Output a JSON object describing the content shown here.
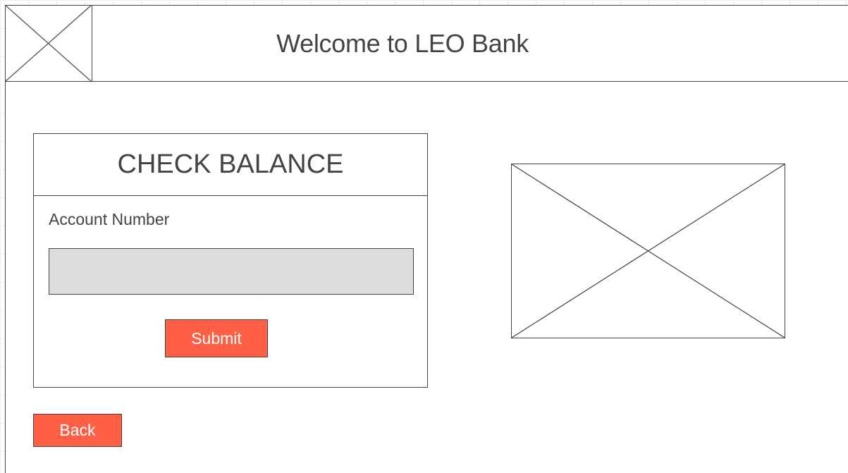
{
  "header": {
    "title": "Welcome to LEO Bank",
    "logo_icon": "image-placeholder-icon"
  },
  "check_balance": {
    "heading": "CHECK BALANCE",
    "account_label": "Account Number",
    "account_value": "",
    "account_placeholder": "",
    "submit_label": "Submit"
  },
  "side_image": {
    "icon": "image-placeholder-icon"
  },
  "navigation": {
    "back_label": "Back"
  },
  "colors": {
    "button": "#ff5f45",
    "input_fill": "#dddddd",
    "stroke": "#444444"
  }
}
